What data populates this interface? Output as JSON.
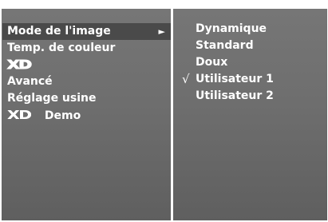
{
  "menu": {
    "items": [
      {
        "label": "Mode de l'image",
        "arrow": "►",
        "selected": true
      },
      {
        "label": "Temp. de couleur"
      },
      {
        "logo": "XD"
      },
      {
        "label": "Avancé"
      },
      {
        "label": "Réglage usine"
      },
      {
        "logo": "XD",
        "label": "Demo"
      }
    ]
  },
  "submenu": {
    "options": [
      {
        "label": "Dynamique"
      },
      {
        "label": "Standard"
      },
      {
        "label": "Doux"
      },
      {
        "label": "Utilisateur 1",
        "checked": true,
        "check_mark": "√"
      },
      {
        "label": "Utilisateur 2"
      }
    ]
  },
  "colors": {
    "panel": "#707070",
    "highlight": "#4a4a4a",
    "text": "#ffffff"
  }
}
